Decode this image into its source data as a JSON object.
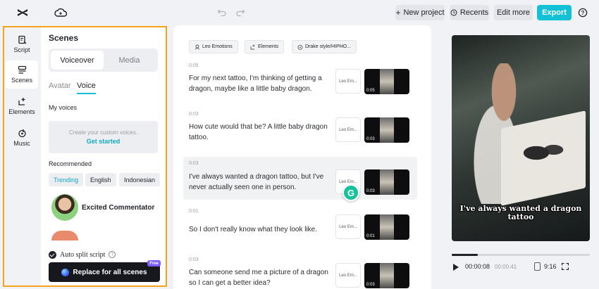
{
  "topbar": {
    "new_project": "New project",
    "recents": "Recents",
    "edit_more": "Edit more",
    "export": "Export",
    "accent": "#12c1d5"
  },
  "rail": {
    "items": [
      {
        "label": "Script",
        "icon": "script-icon"
      },
      {
        "label": "Scenes",
        "icon": "scenes-icon"
      },
      {
        "label": "Elements",
        "icon": "elements-icon"
      },
      {
        "label": "Music",
        "icon": "music-icon"
      }
    ],
    "active": "Scenes"
  },
  "panel": {
    "title": "Scenes",
    "segments": [
      "Voiceover",
      "Media"
    ],
    "subtabs": [
      "Avatar",
      "Voice"
    ],
    "my_voices": "My voices",
    "create_text": "Create your custom voices.",
    "get_started": "Get started",
    "recommended": "Recommended",
    "chips": [
      "Trending",
      "English",
      "Indonesian"
    ],
    "voice_name": "Excited Commentator",
    "auto_split": "Auto split script",
    "replace_btn": "Replace for all scenes",
    "free": "Free",
    "highlight_color": "#f5a31a"
  },
  "script": {
    "tags": [
      "Leo Emotions",
      "Elements",
      "Drake style/HIPHO..."
    ],
    "scenes": [
      {
        "duration": "0:05",
        "text": "For my next tattoo, I'm thinking of getting a dragon, maybe like a little baby dragon.",
        "voice": "Leo Em...",
        "thumb_time": "0:05"
      },
      {
        "duration": "0:03",
        "text": "How cute would that be? A little baby dragon tattoo.",
        "voice": "Leo Em...",
        "thumb_time": "0:03"
      },
      {
        "duration": "0:03",
        "text": "I've always wanted a dragon tattoo, but I've never actually seen one in person.",
        "voice": "Leo Em...",
        "thumb_time": "0:03"
      },
      {
        "duration": "0:01",
        "text": "So I don't really know what they look like.",
        "voice": "Leo Em...",
        "thumb_time": "0:01"
      },
      {
        "duration": "0:03",
        "text": "Can someone send me a picture of a dragon so I can get a better idea?",
        "voice": "Leo Em...",
        "thumb_time": "0:03"
      }
    ],
    "active_index": 2
  },
  "preview": {
    "caption": "I've always wanted a dragon tattoo",
    "current_time": "00:00:08",
    "total_time": "00:00:41",
    "ratio": "9:16",
    "progress": 0.19
  }
}
